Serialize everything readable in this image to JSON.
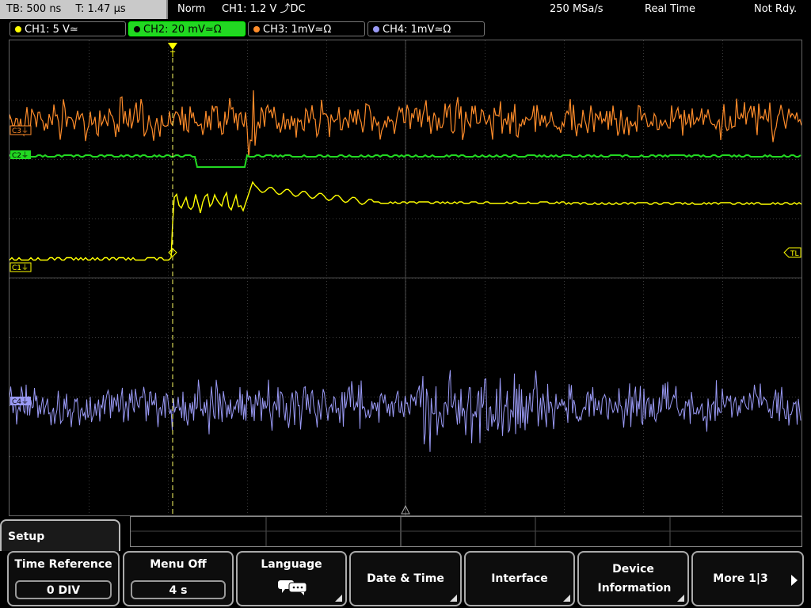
{
  "topbar": {
    "timebase": "TB: 500 ns",
    "trigger_time": "T: 1.47 µs",
    "mode": "Norm",
    "trigger": "CH1: 1.2 V ⤴DC",
    "sample_rate": "250 MSa/s",
    "acq_mode": "Real Time",
    "status": "Not Rdy."
  },
  "channels": [
    {
      "label": "CH1: 5 V≃",
      "color": "#ffff00"
    },
    {
      "label": "CH2: 20 mV≃Ω",
      "color": "#22d822"
    },
    {
      "label": "CH3: 1mV≃Ω",
      "color": "#ff8c2a"
    },
    {
      "label": "CH4: 1mV≃Ω",
      "color": "#9a9af6"
    }
  ],
  "markers": {
    "c3": "C3⏚",
    "c2": "C2⏚",
    "c1": "C1⏚",
    "c4": "C4⏚",
    "trigger_level": "TL",
    "trigger_pos": "T"
  },
  "menu": {
    "title": "Setup",
    "softkeys": [
      {
        "label": "Time Reference",
        "value": "0 DIV"
      },
      {
        "label": "Menu Off",
        "value": "4 s"
      },
      {
        "label": "Language",
        "icon": "speech-bubbles-icon"
      },
      {
        "label": "Date & Time"
      },
      {
        "label": "Interface"
      },
      {
        "label": "Device Information"
      },
      {
        "label": "More 1|3"
      }
    ]
  }
}
